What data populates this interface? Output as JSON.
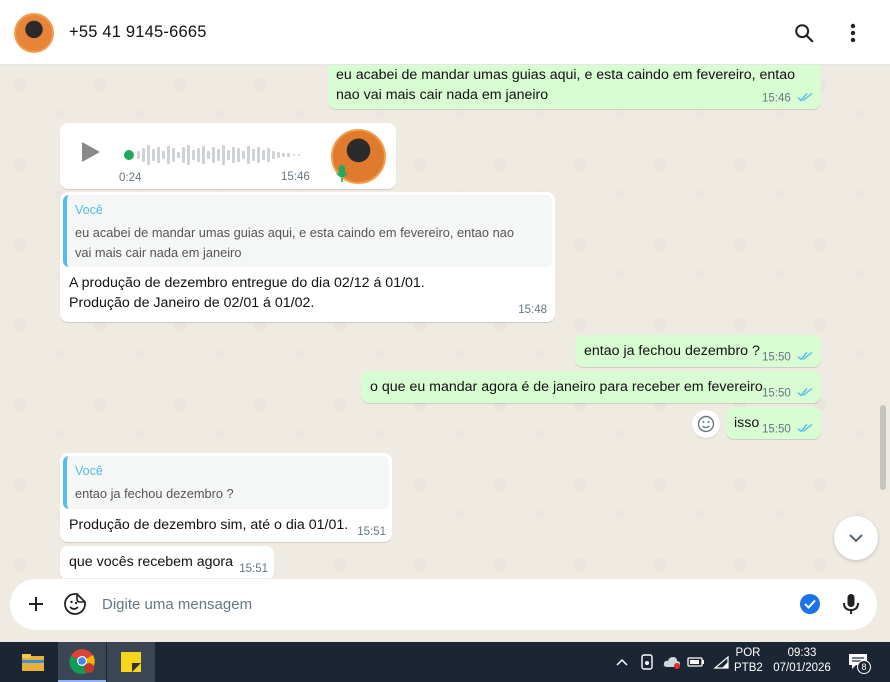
{
  "header": {
    "contact_name": "+55 41 9145-6665",
    "avatar_label": "contact-avatar"
  },
  "messages": [
    {
      "id": "m1",
      "direction": "outgoing",
      "lines": [
        "eu acabei de mandar umas guias aqui, e esta caindo em fevereiro, entao",
        "nao vai mais cair nada em janeiro"
      ],
      "time": "15:46",
      "status": "read"
    },
    {
      "id": "m2",
      "direction": "incoming",
      "type": "voice",
      "duration": "0:24",
      "time": "15:46"
    },
    {
      "id": "m3",
      "direction": "incoming",
      "quote": {
        "author": "Você",
        "lines": [
          "eu acabei de mandar umas guias aqui, e esta caindo em fevereiro, entao nao",
          "vai mais cair nada em janeiro"
        ]
      },
      "lines": [
        "A produção de dezembro entregue do dia 02/12 á 01/01.",
        "Produção de Janeiro de 02/01 á 01/02."
      ],
      "time": "15:48"
    },
    {
      "id": "m4",
      "direction": "outgoing",
      "text": "entao ja fechou dezembro ?",
      "time": "15:50",
      "status": "read"
    },
    {
      "id": "m5",
      "direction": "outgoing",
      "text": "o que eu mandar agora é de janeiro para receber em fevereiro",
      "time": "15:50",
      "status": "read"
    },
    {
      "id": "m6",
      "direction": "outgoing",
      "text": "isso",
      "time": "15:50",
      "status": "read"
    },
    {
      "id": "m7",
      "direction": "incoming",
      "quote": {
        "author": "Você",
        "lines": [
          "entao ja fechou dezembro ?"
        ]
      },
      "text": "Produção de dezembro sim, até o dia 01/01.",
      "time": "15:51"
    },
    {
      "id": "m8",
      "direction": "incoming",
      "text": "que vocês recebem agora",
      "time": "15:51"
    }
  ],
  "composer": {
    "placeholder": "Digite uma mensagem"
  },
  "taskbar": {
    "lang_top": "POR",
    "lang_bottom": "PTB2",
    "clock_time": "09:33",
    "clock_date": "07/01/2026",
    "notification_count": "8"
  },
  "colors": {
    "outgoing_bubble": "#d9fdd3",
    "incoming_bubble": "#ffffff",
    "read_ticks": "#53bdeb",
    "chat_background": "#efeae2",
    "quote_accent": "#53bdeb"
  }
}
